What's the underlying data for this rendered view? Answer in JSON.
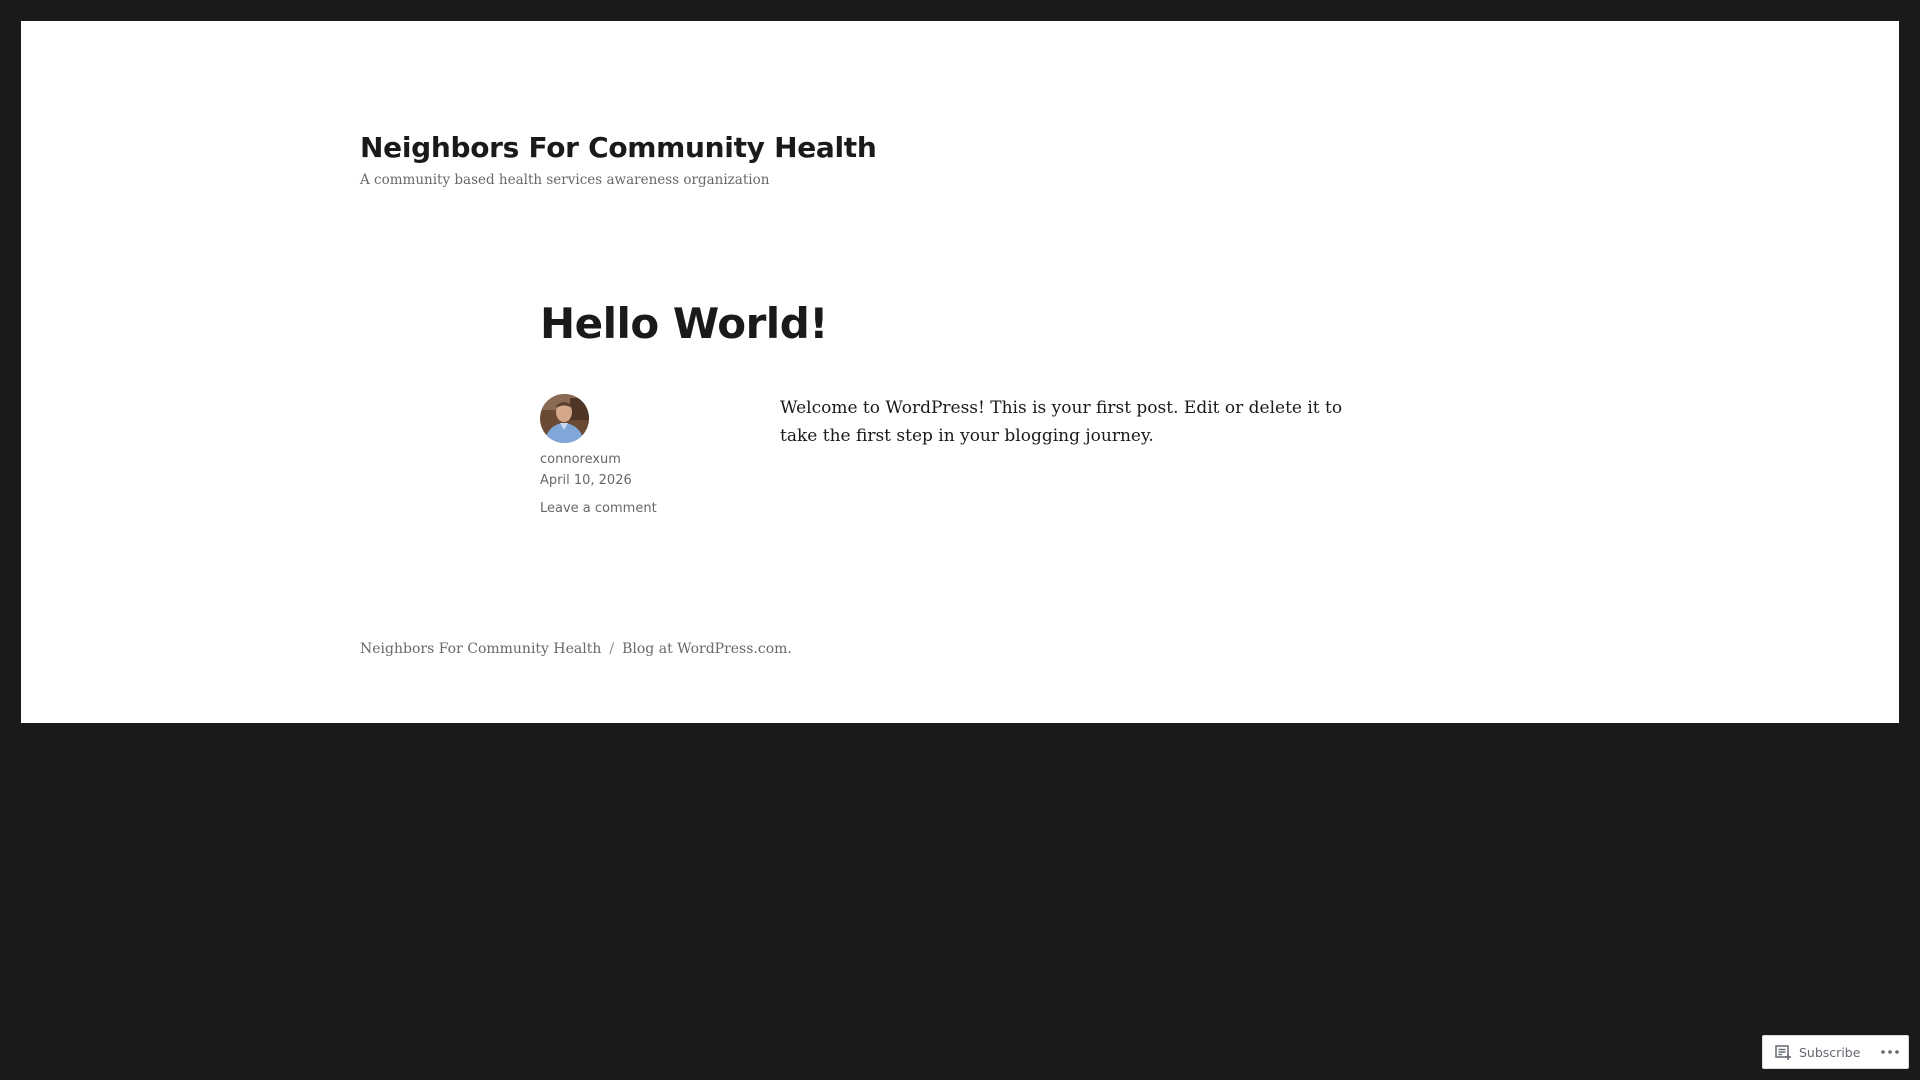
{
  "site": {
    "title": "Neighbors For Community Health",
    "description": "A community based health services awareness organization"
  },
  "post": {
    "title": "Hello World!",
    "author": "connorexum",
    "date": "April 10, 2026",
    "comment_link": "Leave a comment",
    "body": "Welcome to WordPress! This is your first post. Edit or delete it to take the first step in your blogging journey."
  },
  "footer": {
    "site_link": "Neighbors For Community Health",
    "separator": "/",
    "credit_link": "Blog at WordPress.com."
  },
  "action_bar": {
    "subscribe_label": "Subscribe",
    "subscribe_icon": "reader-subscribe-icon",
    "more_icon": "ellipsis-icon"
  },
  "colors": {
    "background_frame": "#1a1a1a",
    "content_background": "#ffffff",
    "text_primary": "#1a1a1a",
    "text_secondary": "#686868"
  }
}
